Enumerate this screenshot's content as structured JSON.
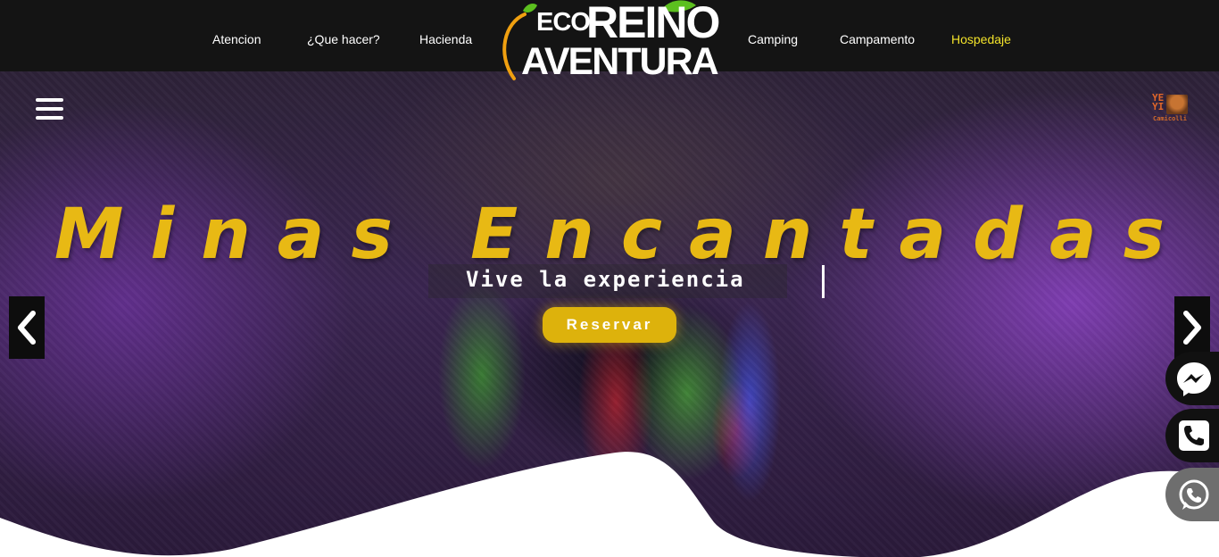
{
  "nav": {
    "left": [
      {
        "label": "Atencion"
      },
      {
        "label": "¿Que hacer?"
      },
      {
        "label": "Hacienda"
      }
    ],
    "right": [
      {
        "label": "Camping"
      },
      {
        "label": "Campamento"
      },
      {
        "label": "Hospedaje"
      }
    ],
    "active_color": "#f2e22a"
  },
  "logo": {
    "eco": "ECO",
    "reino": "REINO",
    "aventura": "AVENTURA",
    "accent_green": "#5cbf1f",
    "accent_orange": "#f0a010"
  },
  "hero": {
    "title": "Minas Encantadas",
    "subtitle": "Vive la experiencia",
    "cta": "Reservar",
    "title_color": "#e8b914",
    "cta_color": "#ddb20c",
    "menu_icon": "hamburger-menu-icon",
    "prev_icon": "chevron-left-icon",
    "next_icon": "chevron-right-icon"
  },
  "badge": {
    "top": "YE",
    "bottom": "YI",
    "caption": "Camicolli"
  },
  "contact": {
    "messenger_icon": "messenger-icon",
    "phone_icon": "phone-icon",
    "whatsapp_icon": "whatsapp-icon"
  }
}
